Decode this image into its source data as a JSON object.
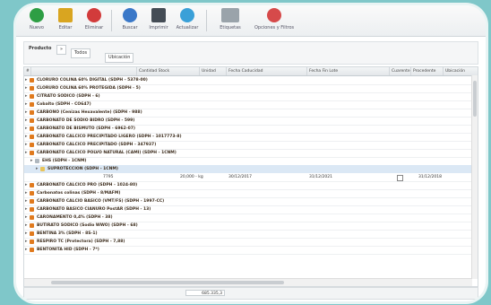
{
  "toolbar": {
    "buttons": [
      {
        "label": "Nuevo",
        "color": "#2e9e44"
      },
      {
        "label": "Editar",
        "color": "#d9a520"
      },
      {
        "label": "Eliminar",
        "color": "#d23b3b"
      },
      {
        "label": "Buscar",
        "color": "#3a78c8"
      },
      {
        "label": "Imprimir",
        "color": "#444c55"
      },
      {
        "label": "Actualizar",
        "color": "#3aa0d8"
      },
      {
        "label": "Etiquetas",
        "color": "#9aa3aa"
      },
      {
        "label": "Opciones y Filtros",
        "color": "#d64a4a"
      }
    ]
  },
  "filterbar": {
    "product_label": "Producto",
    "product_value": "»",
    "all_label": "Todos",
    "location_label": "Ubicación"
  },
  "grid": {
    "columns": [
      "#",
      "Cantidad Stock",
      "Unidad",
      "Fecha Caducidad",
      "Fecha Fin Lote",
      "Cuarentena",
      "Procedente",
      "Ubicación"
    ],
    "rows": [
      {
        "text": "CLORURO COLINA 60% DIGITAL (SDPH - 5378-00)",
        "type": "group"
      },
      {
        "text": "CLORURO COLINA 60% PROTEGIDA (SDPH - 5)",
        "type": "group"
      },
      {
        "text": "CITRATO SODICO (SDPH - 6)",
        "type": "group"
      },
      {
        "text": "Cobalto (SDPH - CO647)",
        "type": "group"
      },
      {
        "text": "CARBONO (Cenizas Hexavalente) (SDPH - 988)",
        "type": "group"
      },
      {
        "text": "CARBONATO DE SODIO BIDRO (SDPH - 599)",
        "type": "group"
      },
      {
        "text": "CARBONATO DE BISMUTO (SDPH - 6962-07)",
        "type": "group"
      },
      {
        "text": "CARBONATO CALCICO PRECIPITADO LIGERO (SDPH - 1017773-8)",
        "type": "group"
      },
      {
        "text": "CARBONATO CALCICO PRECIPITADO (SDPH - 347937)",
        "type": "group"
      },
      {
        "text": "CARBONATO CALCICO POLVO NATURAL (CAMI) (SDPH - 1CNM)",
        "type": "group"
      },
      {
        "text": "EHS (SDPH - 1CNM)",
        "type": "sub"
      },
      {
        "text": "SUPROTECCION (SDPH - 1CNM)",
        "type": "sub2"
      },
      {
        "text": "CARBONATO CALCICO PRO (SDPH - 1024-80)",
        "type": "group"
      },
      {
        "text": "Carbonatos colinas (SDPH - 8/MAFM)",
        "type": "group"
      },
      {
        "text": "CARBONATO CALCIO BASICO (VMT/FS) (SDPH - 1997-CC)",
        "type": "group"
      },
      {
        "text": "CARBONATO BASICO CIANURO PostAR (SDPH - 13)",
        "type": "group"
      },
      {
        "text": "CARONAMENTO 0,4% (SDPH - 38)",
        "type": "group"
      },
      {
        "text": "BUTIRATO SODICO (Sodio WWO) (SDPH - 68)",
        "type": "group"
      },
      {
        "text": "BENTINA 3% (SDPH - 8S-1)",
        "type": "group"
      },
      {
        "text": "RESPIRO TC (Protectora) (SDPH - 7,88)",
        "type": "group"
      },
      {
        "text": "BENTONITA HID (SDPH - 7*)",
        "type": "group"
      }
    ],
    "detail": {
      "code": "7795",
      "qty": "20,000 - kg",
      "date1": "30/12/2017",
      "date2": "31/12/2021",
      "date3": "31/12/2018"
    }
  },
  "status": {
    "value": "685.335,3"
  }
}
